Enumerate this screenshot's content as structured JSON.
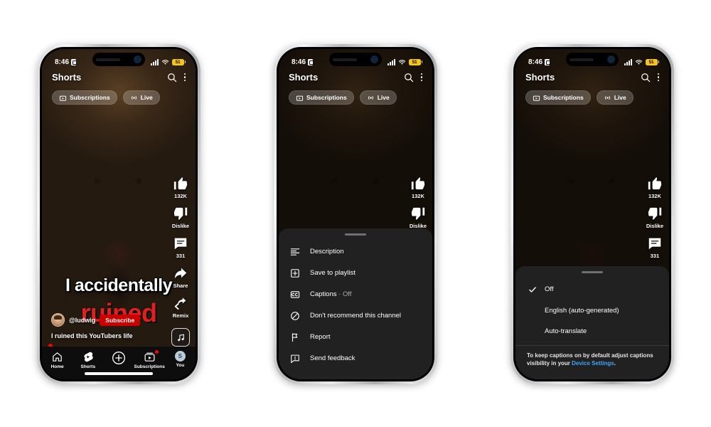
{
  "meta": {
    "app": "YouTube Shorts",
    "platform": "iOS",
    "phone_count": 3
  },
  "status_bar": {
    "time": "8:46",
    "lock_icon": "lock-icon",
    "signal_icon": "cellular-signal-icon",
    "wifi_icon": "wifi-icon",
    "battery_level": "51",
    "battery_state": "low-power-mode",
    "battery_color": "#f5c518"
  },
  "shorts_header": {
    "title": "Shorts",
    "search_icon": "search-icon",
    "more_icon": "more-vertical-icon",
    "chips": [
      {
        "label": "Subscriptions",
        "icon": "subscriptions-icon"
      },
      {
        "label": "Live",
        "icon": "live-broadcast-icon"
      }
    ]
  },
  "video": {
    "caption_line_1": "I accidentally",
    "caption_line_2": "ruined",
    "channel_handle": "@ludwig",
    "subscribe_label": "Subscribe",
    "description": "I ruined this YouTubers life",
    "sound_icon": "music-note-icon",
    "caption_line_2_color": "#e02020",
    "subscribe_color": "#cc0000"
  },
  "action_rail": [
    {
      "icon": "thumbs-up-icon",
      "label": "132K",
      "name": "like-button"
    },
    {
      "icon": "thumbs-down-icon",
      "label": "Dislike",
      "name": "dislike-button"
    },
    {
      "icon": "comment-icon",
      "label": "331",
      "name": "comment-button"
    },
    {
      "icon": "share-arrow-icon",
      "label": "Share",
      "name": "share-button"
    },
    {
      "icon": "remix-icon",
      "label": "Remix",
      "name": "remix-button"
    }
  ],
  "bottom_nav": [
    {
      "label": "Home",
      "icon": "home-icon",
      "badge": false
    },
    {
      "label": "Shorts",
      "icon": "shorts-icon",
      "badge": false
    },
    {
      "label": "",
      "icon": "create-plus-icon",
      "badge": false
    },
    {
      "label": "Subscriptions",
      "icon": "subscriptions-icon",
      "badge": true
    },
    {
      "label": "You",
      "icon": "account-avatar",
      "avatar_initial": "S",
      "badge": false
    }
  ],
  "menu_sheet": {
    "items": [
      {
        "label": "Description",
        "icon": "description-icon",
        "suffix": ""
      },
      {
        "label": "Save to playlist",
        "icon": "save-to-playlist-icon",
        "suffix": ""
      },
      {
        "label": "Captions",
        "icon": "closed-captions-icon",
        "suffix": " · Off"
      },
      {
        "label": "Don't recommend this channel",
        "icon": "block-circle-icon",
        "suffix": ""
      },
      {
        "label": "Report",
        "icon": "flag-icon",
        "suffix": ""
      },
      {
        "label": "Send feedback",
        "icon": "send-feedback-icon",
        "suffix": ""
      }
    ]
  },
  "captions_sheet": {
    "options": [
      {
        "label": "Off",
        "selected": true
      },
      {
        "label": "English (auto-generated)",
        "selected": false
      },
      {
        "label": "Auto-translate",
        "selected": false
      }
    ],
    "footer_text": "To keep captions on by default adjust captions visibility in your ",
    "footer_link": "Device Settings",
    "footer_tail": ".",
    "link_color": "#3ea6ff",
    "check_icon": "checkmark-icon"
  }
}
